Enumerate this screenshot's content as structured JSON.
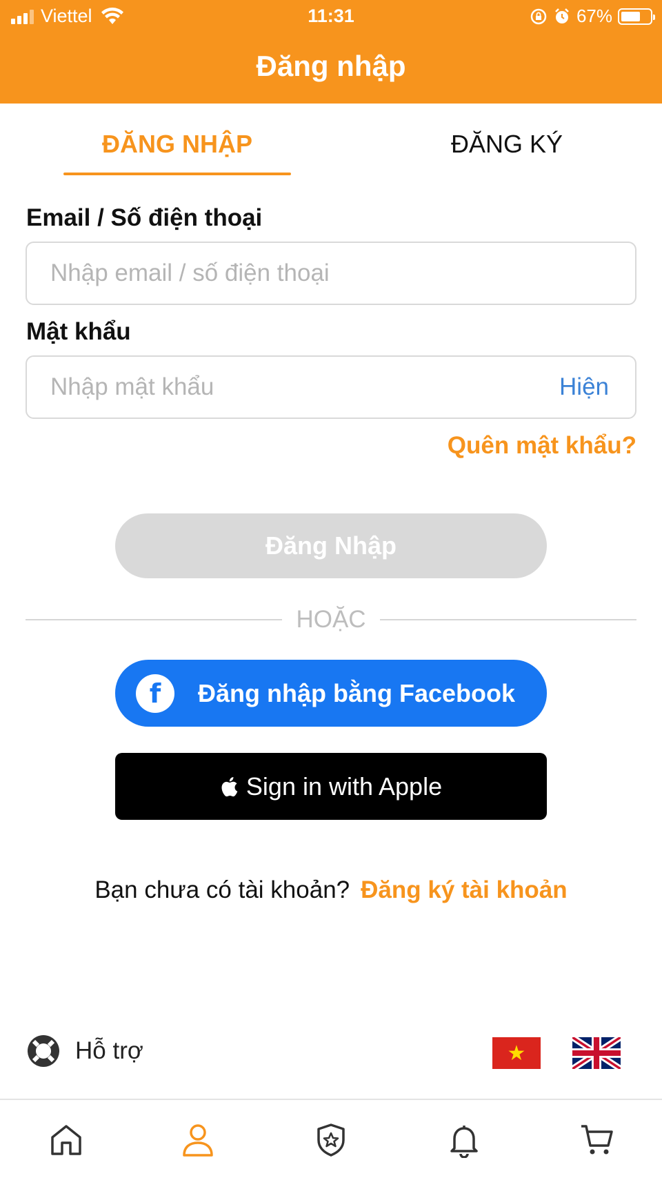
{
  "status_bar": {
    "carrier": "Viettel",
    "time": "11:31",
    "battery": "67%",
    "battery_level": 0.67,
    "icons": [
      "signal-icon",
      "wifi-icon",
      "orientation-lock-icon",
      "alarm-icon",
      "battery-icon"
    ]
  },
  "header": {
    "title": "Đăng nhập"
  },
  "tabs": [
    {
      "label": "ĐĂNG NHẬP",
      "active": true
    },
    {
      "label": "ĐĂNG KÝ",
      "active": false
    }
  ],
  "form": {
    "email_label": "Email / Số điện thoại",
    "email_placeholder": "Nhập email / số điện thoại",
    "email_value": "",
    "password_label": "Mật khẩu",
    "password_placeholder": "Nhập mật khẩu",
    "password_value": "",
    "show_password_label": "Hiện",
    "forgot_password_label": "Quên mật khẩu?",
    "login_button_label": "Đăng Nhập"
  },
  "divider": {
    "label": "HOẶC"
  },
  "social": {
    "facebook_label": "Đăng nhập bằng Facebook",
    "apple_label": "Sign in with Apple"
  },
  "signup": {
    "question": "Bạn chưa có tài khoản?",
    "link": "Đăng ký tài khoản"
  },
  "footer": {
    "support_label": "Hỗ trợ",
    "languages": [
      "vietnam-flag-icon",
      "uk-flag-icon"
    ]
  },
  "bottom_nav": {
    "items": [
      "home-icon",
      "user-icon",
      "badge-star-icon",
      "bell-icon",
      "cart-icon"
    ],
    "active": "user-icon"
  },
  "colors": {
    "brand": "#f7941d",
    "link_blue": "#3b82d6",
    "facebook": "#1877f2",
    "disabled_button": "#d9d9d9"
  }
}
